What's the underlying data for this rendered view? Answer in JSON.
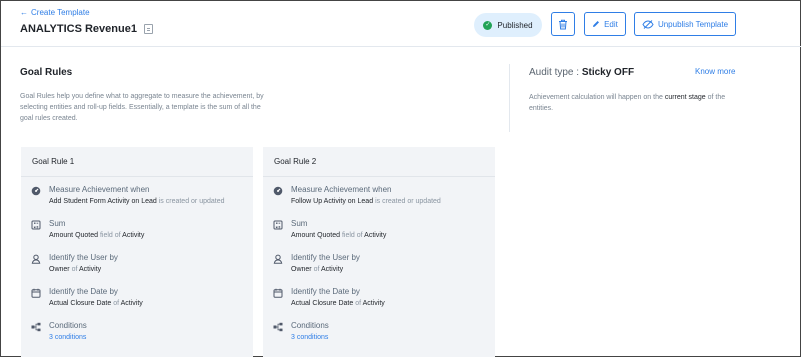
{
  "header": {
    "back_label": "Create Template",
    "title": "ANALYTICS Revenue1",
    "status": "Published",
    "edit_label": "Edit",
    "unpublish_label": "Unpublish Template"
  },
  "goal_rules": {
    "title": "Goal Rules",
    "description": "Goal Rules help you define what to aggregate to measure the achievement, by selecting entities and roll-up fields. Essentially, a template is the sum of all the goal rules created."
  },
  "audit": {
    "label": "Audit type :",
    "value": "Sticky OFF",
    "know_more": "Know more",
    "desc_prefix": "Achievement calculation will happen on the",
    "desc_highlight": "current stage",
    "desc_suffix": "of the entities."
  },
  "rules": [
    {
      "title": "Goal Rule 1",
      "measure_label": "Measure Achievement when",
      "measure_entity": "Add Student Form Activity on Lead",
      "measure_suffix": "is created or updated",
      "sum_label": "Sum",
      "sum_field": "Amount Quoted",
      "sum_of": "field of",
      "sum_entity": "Activity",
      "user_label": "Identify the User by",
      "user_field": "Owner",
      "user_of": "of",
      "user_entity": "Activity",
      "date_label": "Identify the Date by",
      "date_field": "Actual Closure Date",
      "date_of": "of",
      "date_entity": "Activity",
      "conditions_label": "Conditions",
      "conditions_value": "3 conditions"
    },
    {
      "title": "Goal Rule 2",
      "measure_label": "Measure Achievement when",
      "measure_entity": "Follow Up Activity on Lead",
      "measure_suffix": "is created or updated",
      "sum_label": "Sum",
      "sum_field": "Amount Quoted",
      "sum_of": "field of",
      "sum_entity": "Activity",
      "user_label": "Identify the User by",
      "user_field": "Owner",
      "user_of": "of",
      "user_entity": "Activity",
      "date_label": "Identify the Date by",
      "date_field": "Actual Closure Date",
      "date_of": "of",
      "date_entity": "Activity",
      "conditions_label": "Conditions",
      "conditions_value": "3 conditions"
    }
  ],
  "icons": {
    "back": "arrow-left-icon",
    "doc": "document-icon",
    "check": "check-circle-icon",
    "delete": "trash-icon",
    "edit": "pencil-icon",
    "unpublish": "eye-off-icon",
    "measure": "gauge-icon",
    "sum": "calculator-icon",
    "user": "user-icon",
    "date": "calendar-icon",
    "conditions": "branch-icon"
  },
  "colors": {
    "accent": "#2f7ee6",
    "status_bg": "#dfeffd",
    "status_check": "#22a356",
    "card_bg": "#f2f4f7"
  }
}
